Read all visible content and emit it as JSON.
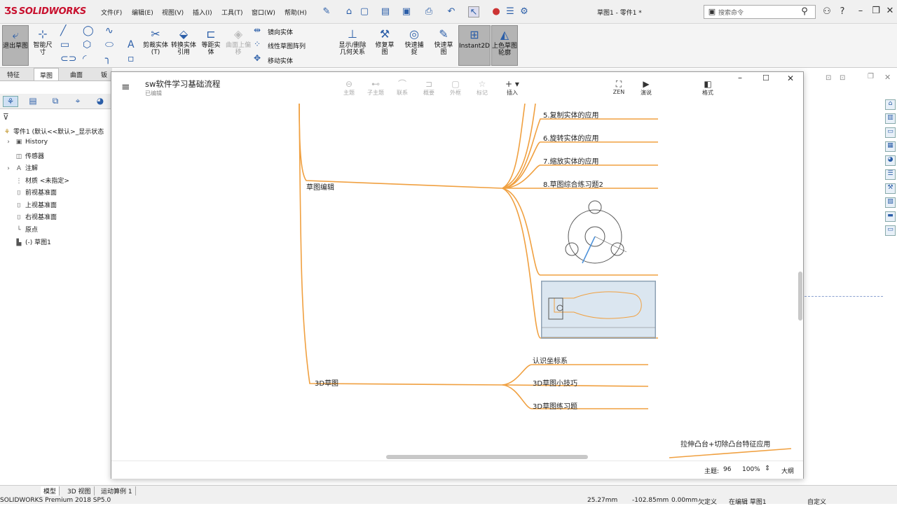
{
  "app": {
    "brand": "SOLIDWORKS",
    "doc_title": "草图1 - 零件1 *"
  },
  "menu": [
    "文件(F)",
    "编辑(E)",
    "视图(V)",
    "插入(I)",
    "工具(T)",
    "窗口(W)",
    "帮助(H)"
  ],
  "search": {
    "placeholder": "搜索命令"
  },
  "ribbon": {
    "exit_sketch": "退出草图",
    "smart_dim": "智能尺寸",
    "trim": "剪裁实体(T)",
    "convert": "转换实体引用",
    "offset": "等距实体",
    "surface_offset": "曲面上偏移",
    "mirror": "镜向实体",
    "linear_pattern": "线性草图阵列",
    "move": "移动实体",
    "display_relations": "显示/删除几何关系",
    "repair": "修复草图",
    "quick_snap": "快速捕捉",
    "rapid_sketch": "快速草图",
    "instant2d": "Instant2D",
    "shaded": "上色草图轮廓"
  },
  "tabs": [
    "特征",
    "草图",
    "曲面",
    "钣"
  ],
  "tree": {
    "root": "零件1 (默认<<默认>_显示状态",
    "items": [
      "History",
      "传感器",
      "注解",
      "材质 <未指定>",
      "前视基准面",
      "上视基准面",
      "右视基准面",
      "原点",
      "(-) 草图1"
    ]
  },
  "bottom": {
    "tabs": [
      "模型",
      "3D 视图",
      "运动算例 1"
    ],
    "product": "SOLIDWORKS Premium 2018 SP5.0",
    "x": "25.27mm",
    "y": "-102.85mm",
    "z": "0.00mm",
    "state": "欠定义",
    "editing": "在编辑 草图1",
    "custom": "自定义"
  },
  "mindmap": {
    "title": "sw软件学习基础流程",
    "subtitle": "已编辑",
    "toolbar": [
      "主题",
      "子主题",
      "联系",
      "概要",
      "外框",
      "标记",
      "插入"
    ],
    "right_tools": [
      "ZEN",
      "演说",
      "格式"
    ],
    "branch1": "草图编辑",
    "b1_items": [
      "5.复制实体的应用",
      "6.旋转实体的应用",
      "7.缩放实体的应用",
      "8.草图综合练习题2"
    ],
    "branch2": "3D草图",
    "b2_items": [
      "认识坐标系",
      "3D草图小技巧",
      "3D草图练习题"
    ],
    "next_topic": "拉伸凸台+切除凸台特征应用",
    "footer": {
      "topics_label": "主题:",
      "topics_count": "96",
      "zoom": "100%",
      "outline": "大纲"
    },
    "branch_color": "#f0a040"
  }
}
